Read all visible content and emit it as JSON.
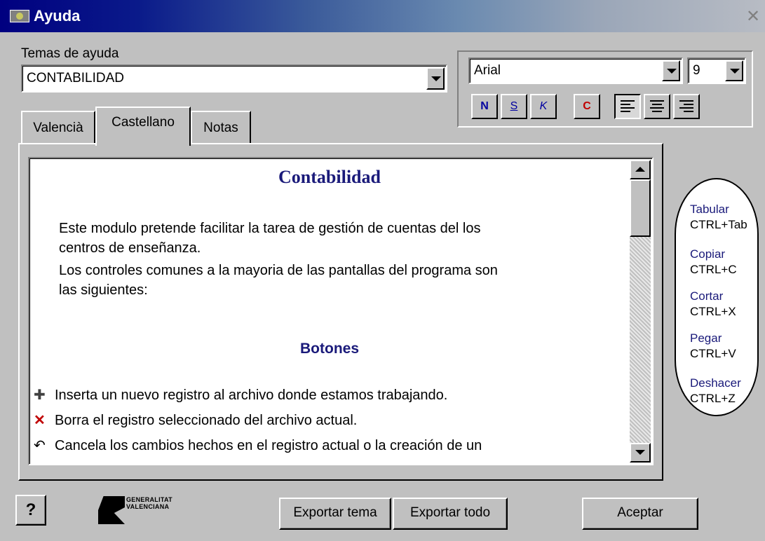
{
  "window": {
    "title": "Ayuda",
    "close_glyph": "✕"
  },
  "temas": {
    "label": "Temas de ayuda",
    "selected": "CONTABILIDAD"
  },
  "font_toolbar": {
    "font_name": "Arial",
    "font_size": "9",
    "style_buttons": [
      {
        "label": "N",
        "color": "#0000a0"
      },
      {
        "label": "S",
        "color": "#0000a0"
      },
      {
        "label": "K",
        "color": "#0000a0"
      },
      {
        "label": "C",
        "color": "#c00000"
      }
    ],
    "align_icons": [
      "align-left-icon",
      "align-center-icon",
      "align-right-icon"
    ]
  },
  "tabs": [
    {
      "label": "Valencià",
      "active": false
    },
    {
      "label": "Castellano",
      "active": true
    },
    {
      "label": "Notas",
      "active": false
    }
  ],
  "content": {
    "title": "Contabilidad",
    "para1_line1": "Este modulo pretende facilitar la tarea de gestión de cuentas del los",
    "para1_line2": "centros de enseñanza.",
    "para2_line1": "Los controles comunes a la mayoria de las  pantallas del programa son",
    "para2_line2": "las siguientes:",
    "subtitle": "Botones",
    "items": [
      {
        "icon": "plus-icon",
        "glyph": "✚",
        "text": "Inserta un nuevo registro al archivo donde estamos trabajando."
      },
      {
        "icon": "delete-x-icon",
        "glyph": "✕",
        "text": "Borra el registro seleccionado del archivo actual."
      },
      {
        "icon": "undo-icon",
        "glyph": "↶",
        "text": "Cancela los cambios hechos en el registro actual o la creación de un"
      }
    ]
  },
  "shortcuts": [
    {
      "name": "Tabular",
      "keys": "CTRL+Tab"
    },
    {
      "name": "Copiar",
      "keys": "CTRL+C"
    },
    {
      "name": "Cortar",
      "keys": "CTRL+X"
    },
    {
      "name": "Pegar",
      "keys": "CTRL+V"
    },
    {
      "name": "Deshacer",
      "keys": "CTRL+Z"
    }
  ],
  "buttons": {
    "help_glyph": "?",
    "export_topic": "Exportar tema",
    "export_all": "Exportar todo",
    "accept": "Aceptar"
  },
  "logo": {
    "line1": "GENERALITAT",
    "line2": "VALENCIANA"
  }
}
